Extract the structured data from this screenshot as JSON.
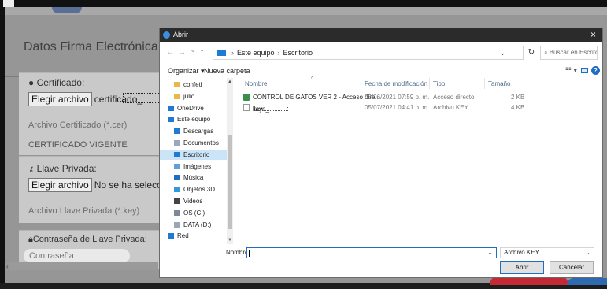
{
  "page": {
    "modal_title": "Datos Firma Electrónica",
    "cert": {
      "label": "Certificado:",
      "choose_btn": "Elegir archivo",
      "file_text": "certificado_",
      "field_label": "Archivo Certificado (*.cer)",
      "status": "CERTIFICADO VIGENTE"
    },
    "key": {
      "label": "Llave Privada:",
      "choose_btn": "Elegir archivo",
      "file_text": "No se ha seleccionado",
      "field_label": "Archivo Llave Privada (*.key)"
    },
    "password": {
      "label": "Contraseña de Llave Privada:",
      "placeholder": "Contraseña"
    }
  },
  "dialog": {
    "title": "Abrir",
    "close": "×",
    "nav": {
      "back": "←",
      "forward": "→",
      "recent": "⌄",
      "up": "↑"
    },
    "address": {
      "root": "Este equipo",
      "sep": "›",
      "folder": "Escritorio",
      "chevron": "⌄"
    },
    "refresh": "↻",
    "search_placeholder": "Buscar en Escritorio",
    "toolbar": {
      "organize": "Organizar ▾",
      "new_folder": "Nueva carpeta",
      "view": "☷ ▾",
      "help": "?"
    },
    "nav_items": [
      {
        "label": "confeti",
        "icon": "folder-icon",
        "color": "#e8b84a"
      },
      {
        "label": "julio",
        "icon": "folder-icon",
        "color": "#e8b84a"
      },
      {
        "label": "OneDrive",
        "icon": "cloud-icon",
        "color": "#1e78d4"
      },
      {
        "label": "Este equipo",
        "icon": "computer-icon",
        "color": "#1e7bd1"
      },
      {
        "label": "Descargas",
        "icon": "download-icon",
        "color": "#1e7bd1"
      },
      {
        "label": "Documentos",
        "icon": "documents-icon",
        "color": "#9aa8b8"
      },
      {
        "label": "Escritorio",
        "icon": "desktop-icon",
        "color": "#1e7bd1",
        "selected": true
      },
      {
        "label": "Imágenes",
        "icon": "pictures-icon",
        "color": "#5ea1d6"
      },
      {
        "label": "Música",
        "icon": "music-icon",
        "color": "#1e6fc1"
      },
      {
        "label": "Objetos 3D",
        "icon": "objects-3d-icon",
        "color": "#2e9ad8"
      },
      {
        "label": "Videos",
        "icon": "videos-icon",
        "color": "#444444"
      },
      {
        "label": "OS (C:)",
        "icon": "drive-icon",
        "color": "#7a8a99"
      },
      {
        "label": "DATA (D:)",
        "icon": "drive-icon",
        "color": "#9aa6b2"
      },
      {
        "label": "Red",
        "icon": "network-icon",
        "color": "#1e7bd1"
      }
    ],
    "columns": {
      "name": "Nombre",
      "modified": "Fecha de modificación",
      "type": "Tipo",
      "size": "Tamaño"
    },
    "files": [
      {
        "name": "CONTROL DE GATOS VER 2 - Acceso dire...",
        "modified": "03/06/2021 07:59 p. m.",
        "type": "Acceso directo",
        "size": "2 KB",
        "icon": "shortcut-icon"
      },
      {
        "name_prefix": "llave_",
        "name_suffix": "key",
        "modified": "05/07/2021 04:41 p. m.",
        "type": "Archivo KEY",
        "size": "4 KB",
        "icon": "file-icon"
      }
    ],
    "filename_label": "Nombre:",
    "filename_value": "",
    "filetype": "Archivo KEY",
    "dropdown": "⌄",
    "open_btn": "Abrir",
    "cancel_btn": "Cancelar"
  }
}
